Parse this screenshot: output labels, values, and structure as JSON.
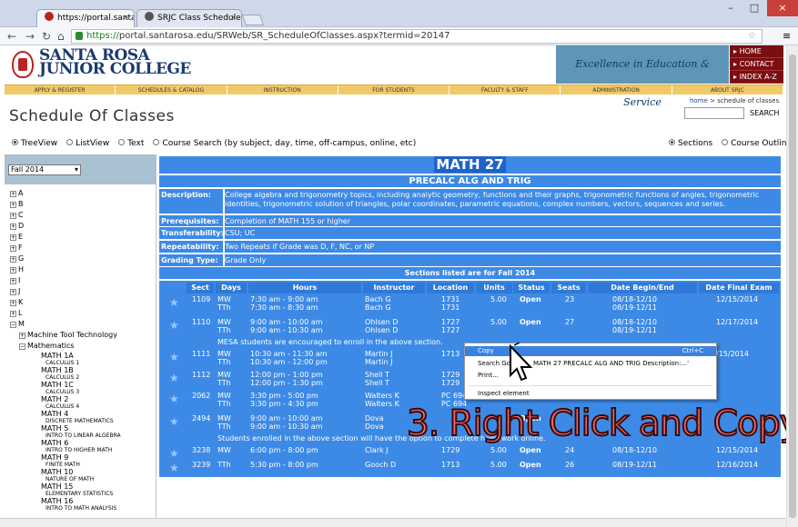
{
  "browser": {
    "tabs": [
      {
        "label": "https://portal.santarosa.e"
      },
      {
        "label": "SRJC Class Scheduler"
      }
    ],
    "url_scheme": "https://",
    "url_rest": "portal.santarosa.edu/SRWeb/SR_ScheduleOfClasses.aspx?termid=20147"
  },
  "header": {
    "college_line1": "SANTA ROSA",
    "college_line2": "JUNIOR COLLEGE",
    "slogan": "Excellence in Education & Service",
    "quick_links": [
      "HOME",
      "CONTACT",
      "INDEX A-Z"
    ]
  },
  "nav": [
    "APPLY & REGISTER",
    "SCHEDULES & CATALOG",
    "INSTRUCTION",
    "FOR STUDENTS",
    "FACULTY & STAFF",
    "ADMINISTRATION",
    "ABOUT SRJC"
  ],
  "page": {
    "title": "Schedule Of Classes",
    "breadcrumb_home": "home",
    "breadcrumb_sep": ">",
    "breadcrumb_current": "schedule of classes",
    "search_label": "SEARCH"
  },
  "view_options": [
    "TreeView",
    "ListView",
    "Text",
    "Course Search (by subject, day, time, off-campus, online, etc)"
  ],
  "section_options": [
    "Sections",
    "Course Outline"
  ],
  "term": "Fall 2014",
  "tree": {
    "letters": [
      "A",
      "B",
      "C",
      "D",
      "E",
      "F",
      "G",
      "H",
      "I",
      "J",
      "K",
      "L",
      "M"
    ],
    "m_children": [
      "Machine Tool Technology",
      "Mathematics"
    ],
    "courses": [
      {
        "code": "MATH 1A",
        "name": "CALCULUS 1"
      },
      {
        "code": "MATH 1B",
        "name": "CALCULUS 2"
      },
      {
        "code": "MATH 1C",
        "name": "CALCULUS 3"
      },
      {
        "code": "MATH 2",
        "name": "CALCULUS 4"
      },
      {
        "code": "MATH 4",
        "name": "DISCRETE MATHEMATICS"
      },
      {
        "code": "MATH 5",
        "name": "INTRO TO LINEAR ALGEBRA"
      },
      {
        "code": "MATH 6",
        "name": "INTRO TO HIGHER MATH"
      },
      {
        "code": "MATH 9",
        "name": "FINITE MATH"
      },
      {
        "code": "MATH 10",
        "name": "NATURE OF MATH"
      },
      {
        "code": "MATH 15",
        "name": "ELEMENTARY STATISTICS"
      },
      {
        "code": "MATH 16",
        "name": "INTRO TO MATH ANALYSIS"
      }
    ]
  },
  "course": {
    "code": "MATH 27",
    "title": "PRECALC ALG AND TRIG",
    "info": [
      {
        "label": "Description:",
        "value": "College algebra and trigonometry topics, including analytic geometry, functions and their graphs, trigonometric functions of angles, trigonometric identities, trigonometric solution of triangles, polar coordinates, parametric equations, complex numbers, vectors, sequences and series."
      },
      {
        "label": "Prerequisites:",
        "value": "Completion of MATH 155 or higher"
      },
      {
        "label": "Transferability:",
        "value": "CSU; UC"
      },
      {
        "label": "Repeatability:",
        "value": "Two Repeats if Grade was D, F, NC, or NP"
      },
      {
        "label": "Grading Type:",
        "value": "Grade Only"
      }
    ],
    "sections_heading": "Sections listed are for Fall 2014",
    "headers": [
      "Sect",
      "Days",
      "Hours",
      "Instructor",
      "Location",
      "Units",
      "Status",
      "Seats",
      "Date Begin/End",
      "Date Final Exam"
    ],
    "rows": [
      {
        "sect": "1109",
        "days": [
          "MW",
          "TTh"
        ],
        "hours": [
          "7:30 am - 9:00 am",
          "7:30 am - 8:30 am"
        ],
        "instr": [
          "Bach G",
          "Bach G"
        ],
        "loc": [
          "1731",
          "1731"
        ],
        "units": "5.00",
        "status": "Open",
        "seats": "23",
        "dates": [
          "08/18-12/10",
          "08/19-12/11"
        ],
        "final": "12/15/2014"
      },
      {
        "sect": "1110",
        "days": [
          "MW",
          "TTh"
        ],
        "hours": [
          "9:00 am - 10:00 am",
          "9:00 am - 10:30 am"
        ],
        "instr": [
          "Ohlsen D",
          "Ohlsen D"
        ],
        "loc": [
          "1727",
          "1727"
        ],
        "units": "5.00",
        "status": "Open",
        "seats": "27",
        "dates": [
          "08/18-12/10",
          "08/19-12/11"
        ],
        "final": "12/17/2014"
      },
      {
        "sect": "1111",
        "days": [
          "MW",
          "TTh"
        ],
        "hours": [
          "10:30 am - 11:30 am",
          "10:30 am - 12:00 pm"
        ],
        "instr": [
          "Martin J",
          "Martin J"
        ],
        "loc": [
          "1713",
          ""
        ],
        "units": "",
        "status": "",
        "seats": "",
        "dates": [
          "",
          ""
        ],
        "final": "/15/2014"
      },
      {
        "sect": "1112",
        "days": [
          "MW",
          "TTh"
        ],
        "hours": [
          "12:00 pm - 1:00 pm",
          "12:00 pm - 1:30 pm"
        ],
        "instr": [
          "Shell T",
          "Shell T"
        ],
        "loc": [
          "1729",
          "1729"
        ],
        "units": "",
        "status": "",
        "seats": "",
        "dates": [
          "",
          ""
        ],
        "final": ""
      },
      {
        "sect": "2062",
        "days": [
          "MW",
          "TTh"
        ],
        "hours": [
          "3:30 pm - 5:00 pm",
          "3:30 pm - 4:30 pm"
        ],
        "instr": [
          "Walters K",
          "Walters K"
        ],
        "loc": [
          "PC 694",
          "PC 694"
        ],
        "units": "",
        "status": "",
        "seats": "",
        "dates": [
          "",
          ""
        ],
        "final": ""
      },
      {
        "sect": "2494",
        "days": [
          "MW",
          "TTh"
        ],
        "hours": [
          "9:00 am - 10:00 am",
          "9:00 am - 10:30 am"
        ],
        "instr": [
          "Dova",
          "Dova"
        ],
        "loc": [
          "",
          ""
        ],
        "units": "",
        "status": "Open",
        "seats": "",
        "dates": [
          "",
          ""
        ],
        "final": ""
      },
      {
        "sect": "3238",
        "days": [
          "MW"
        ],
        "hours": [
          "6:00 pm - 8:00 pm"
        ],
        "instr": [
          "Clark J"
        ],
        "loc": [
          "1729"
        ],
        "units": "5.00",
        "status": "Open",
        "seats": "24",
        "dates": [
          "08/18-12/10"
        ],
        "final": "12/15/2014"
      },
      {
        "sect": "3239",
        "days": [
          "TTh"
        ],
        "hours": [
          "5:30 pm - 8:00 pm"
        ],
        "instr": [
          "Gooch D"
        ],
        "loc": [
          "1713"
        ],
        "units": "5.00",
        "status": "Open",
        "seats": "26",
        "dates": [
          "08/19-12/11"
        ],
        "final": "12/16/2014"
      }
    ],
    "note_mesa": "MESA students are encouraged to enroll in the above section.",
    "note_hw": "Students enrolled in the above section will have the option to complete homework online."
  },
  "context_menu": {
    "copy": "Copy",
    "copy_shortcut": "Ctrl+C",
    "search_left": "Search Goo",
    "search_right": "MATH 27 PRECALC ALG AND TRIG Description:...'",
    "print": "Print...",
    "inspect": "Inspect element"
  },
  "overlay_caption": "3. Right Click and Copy"
}
